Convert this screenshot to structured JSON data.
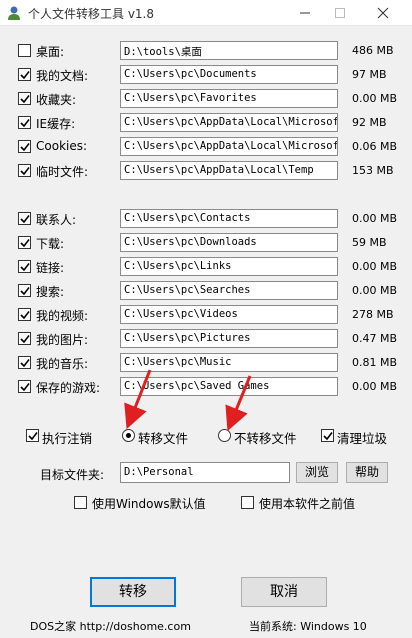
{
  "window": {
    "title": "个人文件转移工具 v1.8",
    "icon": "user-app-icon"
  },
  "folders": [
    {
      "label": "桌面:",
      "checked": false,
      "path": "D:\\tools\\桌面",
      "size": "486 MB"
    },
    {
      "label": "我的文档:",
      "checked": true,
      "path": "C:\\Users\\pc\\Documents",
      "size": "97 MB"
    },
    {
      "label": "收藏夹:",
      "checked": true,
      "path": "C:\\Users\\pc\\Favorites",
      "size": "0.00 MB"
    },
    {
      "label": "IE缓存:",
      "checked": true,
      "path": "C:\\Users\\pc\\AppData\\Local\\Microsoft\\",
      "size": "92 MB"
    },
    {
      "label": "Cookies:",
      "checked": true,
      "path": "C:\\Users\\pc\\AppData\\Local\\Microsoft\\",
      "size": "0.06 MB"
    },
    {
      "label": "临时文件:",
      "checked": true,
      "path": "C:\\Users\\pc\\AppData\\Local\\Temp",
      "size": "153 MB"
    },
    {
      "label": "联系人:",
      "checked": true,
      "path": "C:\\Users\\pc\\Contacts",
      "size": "0.00 MB"
    },
    {
      "label": "下载:",
      "checked": true,
      "path": "C:\\Users\\pc\\Downloads",
      "size": "59 MB"
    },
    {
      "label": "链接:",
      "checked": true,
      "path": "C:\\Users\\pc\\Links",
      "size": "0.00 MB"
    },
    {
      "label": "搜索:",
      "checked": true,
      "path": "C:\\Users\\pc\\Searches",
      "size": "0.00 MB"
    },
    {
      "label": "我的视频:",
      "checked": true,
      "path": "C:\\Users\\pc\\Videos",
      "size": "278 MB"
    },
    {
      "label": "我的图片:",
      "checked": true,
      "path": "C:\\Users\\pc\\Pictures",
      "size": "0.47 MB"
    },
    {
      "label": "我的音乐:",
      "checked": true,
      "path": "C:\\Users\\pc\\Music",
      "size": "0.81 MB"
    },
    {
      "label": "保存的游戏:",
      "checked": true,
      "path": "C:\\Users\\pc\\Saved Games",
      "size": "0.00 MB"
    }
  ],
  "options": {
    "logout_label": "执行注销",
    "logout_checked": true,
    "transfer_label": "转移文件",
    "transfer_selected": true,
    "no_transfer_label": "不转移文件",
    "no_transfer_selected": false,
    "cleanup_label": "清理垃圾",
    "cleanup_checked": true
  },
  "target": {
    "label": "目标文件夹:",
    "value": "D:\\Personal",
    "browse_label": "浏览",
    "help_label": "帮助"
  },
  "defaults": {
    "windows_default_label": "使用Windows默认值",
    "windows_default_checked": false,
    "previous_label": "使用本软件之前值",
    "previous_checked": false
  },
  "actions": {
    "transfer_label": "转移",
    "cancel_label": "取消"
  },
  "footer": {
    "left": "DOS之家  http://doshome.com",
    "right": "当前系统: Windows 10"
  },
  "colors": {
    "accent_border": "#0078d7",
    "arrow": "#e02020"
  }
}
